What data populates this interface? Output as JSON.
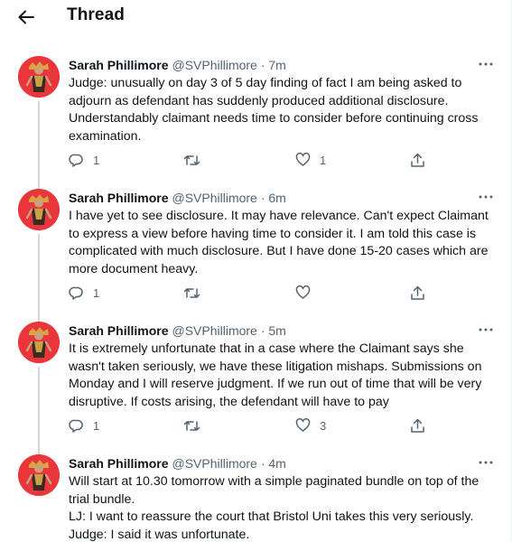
{
  "header": {
    "title": "Thread"
  },
  "tweets": [
    {
      "name": "Sarah Phillimore",
      "handle": "@SVPhillimore",
      "time": "· 7m",
      "lines": [
        "Judge: unusually on day 3 of 5 day finding of fact I am being asked to",
        "adjourn as defendant has suddenly produced additional disclosure.",
        "Understandably claimant needs time to consider before continuing cross",
        "examination."
      ],
      "replies": "1",
      "retweets": "",
      "likes": "1"
    },
    {
      "name": "Sarah Phillimore",
      "handle": "@SVPhillimore",
      "time": "· 6m",
      "lines": [
        "I have yet to see disclosure. It may have relevance. Can't expect Claimant",
        "to express a view before having time to consider it. I am told this case is",
        "complicated with much disclosure. But I have done 15-20 cases which are",
        "more document heavy."
      ],
      "replies": "1",
      "retweets": "",
      "likes": ""
    },
    {
      "name": "Sarah Phillimore",
      "handle": "@SVPhillimore",
      "time": "· 5m",
      "lines": [
        "It is extremely unfortunate that in a case where the Claimant says she",
        "wasn't taken seriously, we have these litigation mishaps. Submissions on",
        "Monday and I will reserve judgment. If we run out of time that will be very",
        "disruptive. If costs arising, the defendant will have to pay"
      ],
      "replies": "1",
      "retweets": "",
      "likes": "3"
    },
    {
      "name": "Sarah Phillimore",
      "handle": "@SVPhillimore",
      "time": "· 4m",
      "lines": [
        "Will start at 10.30 tomorrow with a simple paginated bundle on top of the",
        "trial bundle.",
        "LJ: I want to reassure the court that Bristol Uni takes this very seriously.",
        "Judge: I said it was unfortunate."
      ],
      "replies": "",
      "retweets": "",
      "likes": ""
    }
  ],
  "colors": {
    "muted": "#536471",
    "avatar_bg": "#e8363a",
    "line": "#cfd9de"
  },
  "icons": [
    "back-arrow-icon",
    "more-icon",
    "reply-icon",
    "retweet-icon",
    "like-icon",
    "share-icon"
  ]
}
